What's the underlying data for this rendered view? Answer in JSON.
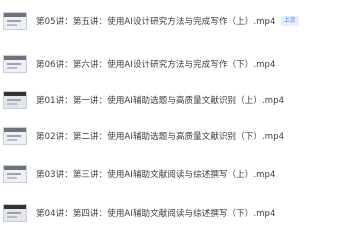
{
  "files": [
    {
      "name": "第05讲：第五讲：使用AI设计研究方法与完成写作（上）.mp4",
      "badge": "上次",
      "thumb_icon": "video-thumbnail-icon"
    },
    {
      "name": "第06讲：第六讲：使用AI设计研究方法与完成写作（下）.mp4",
      "thumb_icon": "video-thumbnail-icon"
    },
    {
      "name": "第01讲：第一讲：使用AI辅助选题与高质量文献识别（上）.mp4",
      "thumb_icon": "video-thumbnail-icon"
    },
    {
      "name": "第02讲：第二讲：使用AI辅助选题与高质量文献识别（下）.mp4",
      "thumb_icon": "video-thumbnail-icon"
    },
    {
      "name": "第03讲：第三讲：使用AI辅助文献阅读与综述撰写（上）.mp4",
      "thumb_icon": "video-thumbnail-icon"
    },
    {
      "name": "第04讲：第四讲：使用AI辅助文献阅读与综述撰写（下）.mp4",
      "thumb_icon": "video-thumbnail-icon"
    }
  ]
}
